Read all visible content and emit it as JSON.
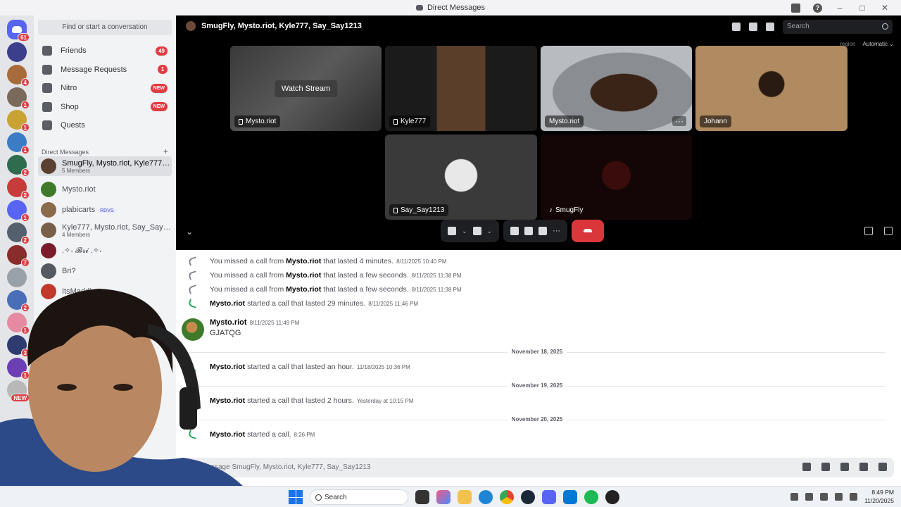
{
  "window": {
    "title": "Direct Messages"
  },
  "servers": [
    {
      "badge": "61",
      "color": "#5865f2",
      "home": true
    },
    {
      "badge": "",
      "color": "#3b3f8c"
    },
    {
      "badge": "4",
      "color": "#a86b3c"
    },
    {
      "badge": "1",
      "color": "#7a6a5c"
    },
    {
      "badge": "1",
      "color": "#c9a234"
    },
    {
      "badge": "1",
      "color": "#3c7cc4"
    },
    {
      "badge": "2",
      "color": "#2f6b4e"
    },
    {
      "badge": "2",
      "color": "#c83b3b"
    },
    {
      "badge": "1",
      "color": "#5865f2"
    },
    {
      "badge": "2",
      "color": "#55606e"
    },
    {
      "badge": "7",
      "color": "#8a2c2c"
    },
    {
      "badge": "",
      "color": "#9aa0a8"
    },
    {
      "badge": "2",
      "color": "#4a6fb8"
    },
    {
      "badge": "1",
      "color": "#e58aa0"
    },
    {
      "badge": "3",
      "color": "#2d3b6e"
    },
    {
      "badge": "1",
      "color": "#6c3fb5"
    },
    {
      "badge": "NEW",
      "color": "#b8b8b8"
    }
  ],
  "sidebar": {
    "search_placeholder": "Find or start a conversation",
    "nav": [
      {
        "label": "Friends",
        "count": "49",
        "icon": "friends-icon"
      },
      {
        "label": "Message Requests",
        "count": "1",
        "icon": "message-requests-icon"
      },
      {
        "label": "Nitro",
        "new": "NEW",
        "icon": "nitro-icon"
      },
      {
        "label": "Shop",
        "new": "NEW",
        "icon": "shop-icon"
      },
      {
        "label": "Quests",
        "icon": "quests-icon"
      }
    ],
    "dm_header": "Direct Messages",
    "dm_add": "+",
    "dms": [
      {
        "name": "SmugFly, Mysto.riot, Kyle777, ...",
        "sub": "5 Members",
        "color": "#5a4030",
        "active": true
      },
      {
        "name": "Mysto.riot",
        "sub": "",
        "color": "#3f7a2a"
      },
      {
        "name": "plabicarts",
        "sub": "",
        "tag": "RDVS",
        "color": "#8b6b4a"
      },
      {
        "name": "Kyle777, Mysto.riot, Say_Say1...",
        "sub": "4 Members",
        "color": "#7a6048"
      },
      {
        "name": ".✧˖ 𝓑𝓻𝓲 .✧˖",
        "sub": "",
        "color": "#7a1c2c"
      },
      {
        "name": "Bri?",
        "sub": "",
        "color": "#555a62"
      },
      {
        "name": "ItsMaddie",
        "sub": "",
        "color": "#c0392b"
      }
    ]
  },
  "call": {
    "title": "SmugFly, Mysto.riot, Kyle777, Say_Say1213",
    "search_placeholder": "Search",
    "region_label": "region",
    "quality": "Automatic",
    "tiles": [
      {
        "name": "Mysto.riot",
        "overlay": "Watch Stream",
        "device": "screen"
      },
      {
        "name": "Kyle777",
        "device": "phone"
      },
      {
        "name": "Mysto.riot",
        "device": ""
      },
      {
        "name": "Johann",
        "device": ""
      },
      {
        "name": "Say_Say1213",
        "device": "phone"
      },
      {
        "name": "SmugFly",
        "device": "console"
      }
    ],
    "more": "···"
  },
  "messages": {
    "system": [
      {
        "type": "missed",
        "pre": "You missed a call from ",
        "who": "Mysto.riot",
        "post": " that lasted 4 minutes.",
        "ts": "8/11/2025 10:40 PM"
      },
      {
        "type": "missed",
        "pre": "You missed a call from ",
        "who": "Mysto.riot",
        "post": " that lasted a few seconds.",
        "ts": "8/11/2025 11:38 PM"
      },
      {
        "type": "missed",
        "pre": "You missed a call from ",
        "who": "Mysto.riot",
        "post": " that lasted a few seconds.",
        "ts": "8/11/2025 11:38 PM"
      },
      {
        "type": "ok",
        "pre": "",
        "who": "Mysto.riot",
        "post": " started a call that lasted 29 minutes.",
        "ts": "8/11/2025 11:46 PM"
      }
    ],
    "chat": {
      "author": "Mysto.riot",
      "ts": "8/11/2025 11:49 PM",
      "text": "GJATQG"
    },
    "dividers": [
      "November 18, 2025",
      "November 19, 2025",
      "November 20, 2025"
    ],
    "later": [
      {
        "who": "Mysto.riot",
        "post": " started a call that lasted an hour.",
        "ts": "11/18/2025 10:36 PM"
      },
      {
        "who": "Mysto.riot",
        "post": " started a call that lasted 2 hours.",
        "ts": "Yesterday at 10:15 PM"
      },
      {
        "who": "Mysto.riot",
        "post": " started a call.",
        "ts": "8:26 PM"
      }
    ],
    "composer_placeholder": "ssage SmugFly, Mysto.riot, Kyle777, Say_Say1213"
  },
  "taskbar": {
    "search": "Search",
    "time": "8:49 PM",
    "date": "11/20/2025"
  }
}
